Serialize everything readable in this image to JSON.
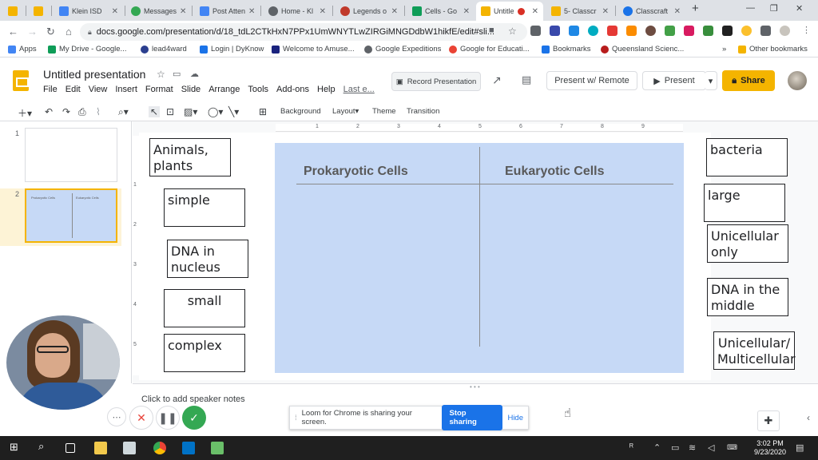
{
  "browser": {
    "tabs": [
      {
        "label": "",
        "color": "#f4b400"
      },
      {
        "label": "",
        "color": "#f4b400"
      },
      {
        "label": "Klein ISD",
        "color": "#4285f4"
      },
      {
        "label": "Messages",
        "color": "#34a853"
      },
      {
        "label": "Post Atten",
        "color": "#4285f4"
      },
      {
        "label": "Home - Kl",
        "color": "#5f6368"
      },
      {
        "label": "Legends o",
        "color": "#c0392b"
      },
      {
        "label": "Cells - Go",
        "color": "#0f9d58"
      },
      {
        "label": "Untitle",
        "color": "#f4b400"
      },
      {
        "label": "5- Classcr",
        "color": "#f4b400"
      },
      {
        "label": "Classcraft",
        "color": "#1a73e8"
      }
    ],
    "new_tab": "+",
    "url": "docs.google.com/presentation/d/18_tdL2CTkHxN7PPx1UmWNYTLwZIRGiMNGDdbW1hikfE/edit#sli..."
  },
  "bookmarks": [
    {
      "label": "Apps",
      "color": "#4285f4"
    },
    {
      "label": "My Drive - Google...",
      "color": "#0f9d58"
    },
    {
      "label": "lead4ward",
      "color": "#2b3f8f"
    },
    {
      "label": "Login | DyKnow",
      "color": "#1a73e8"
    },
    {
      "label": "Welcome to Amuse...",
      "color": "#1a237e"
    },
    {
      "label": "Google Expeditions",
      "color": "#5f6368"
    },
    {
      "label": "Google for Educati...",
      "color": "#ea4335"
    },
    {
      "label": "Bookmarks",
      "color": "#1a73e8"
    },
    {
      "label": "Queensland Scienc...",
      "color": "#b71c1c"
    }
  ],
  "bookmarks_more": "»",
  "other_bookmarks": "Other bookmarks",
  "slides": {
    "title": "Untitled presentation",
    "menu": [
      "File",
      "Edit",
      "View",
      "Insert",
      "Format",
      "Slide",
      "Arrange",
      "Tools",
      "Add-ons",
      "Help"
    ],
    "last_edit": "Last e...",
    "record_label": "Record Presentation",
    "present_remote_label": "Present w/ Remote",
    "present_label": "Present",
    "share_label": "Share",
    "toolbar": {
      "background": "Background",
      "layout": "Layout",
      "theme": "Theme",
      "transition": "Transition"
    },
    "ruler_marks": [
      "1",
      "2",
      "3",
      "4",
      "5",
      "6",
      "7",
      "8",
      "9"
    ],
    "vruler_marks": [
      "1",
      "2",
      "3",
      "4",
      "5"
    ],
    "slide_numbers": [
      "1",
      "2"
    ],
    "thumb2_left": "Prokaryotic Cells",
    "thumb2_right": "Eukaryotic Cells",
    "columns": [
      "Prokaryotic Cells",
      "Eukaryotic Cells"
    ],
    "left_cards": [
      "Animals, plants",
      "simple",
      "DNA in nucleus",
      "small",
      "complex"
    ],
    "right_cards": [
      "bacteria",
      "large",
      "Unicellular only",
      "DNA in the middle",
      "Unicellular/ Multicellular"
    ],
    "speaker_notes": "Click to add speaker notes"
  },
  "loom": {
    "message": "Loom for Chrome is sharing your screen.",
    "stop_label": "Stop sharing",
    "hide_label": "Hide"
  },
  "taskbar": {
    "time": "3:02 PM",
    "date": "9/23/2020"
  },
  "colors": {
    "accent": "#f4b400",
    "table_fill": "#c6d9f6",
    "loom_blue": "#1a73e8"
  }
}
